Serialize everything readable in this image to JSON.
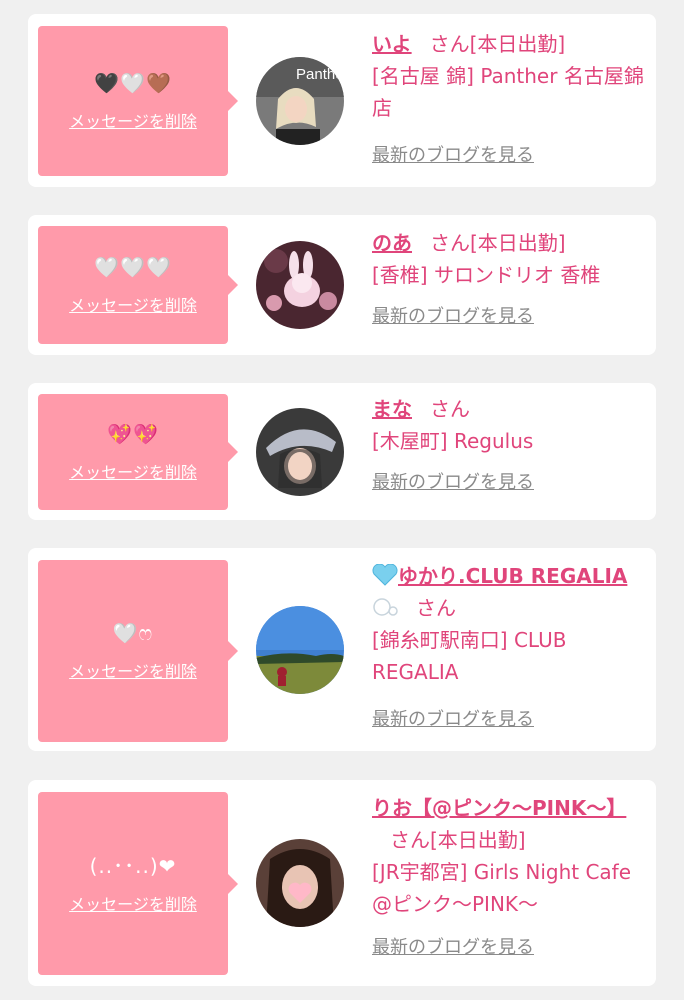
{
  "cards": [
    {
      "message": "🖤🤍🤎",
      "delete_label": "メッセージを削除",
      "name": "いよ",
      "san": "さん",
      "status": "[本日出勤]",
      "shop": "[名古屋 錦] Panther 名古屋錦店",
      "blog_label": "最新のブログを見る",
      "avatar_text": "Panther"
    },
    {
      "message": "🤍🤍🤍",
      "delete_label": "メッセージを削除",
      "name": "のあ",
      "san": "さん",
      "status": "[本日出勤]",
      "shop": "[香椎] サロンドリオ 香椎",
      "blog_label": "最新のブログを見る"
    },
    {
      "message": "💖💖",
      "delete_label": "メッセージを削除",
      "name": "まな",
      "san": "さん",
      "status": "",
      "shop": "[木屋町] Regulus",
      "blog_label": "最新のブログを見る"
    },
    {
      "message": "🤍ෆ",
      "delete_label": "メッセージを削除",
      "name": "ゆかり.CLUB REGALIA",
      "san": "さん",
      "status": "",
      "shop": "[錦糸町駅南口] CLUB REGALIA",
      "blog_label": "最新のブログを見る"
    },
    {
      "message": "(..･･..)❤",
      "delete_label": "メッセージを削除",
      "name": "りお【@ピンク〜PINK〜】",
      "san": "さん",
      "status": "[本日出勤]",
      "shop": "[JR宇都宮] Girls Night Cafe @ピンク〜PINK〜",
      "blog_label": "最新のブログを見る"
    }
  ],
  "colors": {
    "accent": "#e0457b",
    "bubble": "#ff9aaa",
    "background": "#f0f0f0",
    "blog_link": "#8a8a8a"
  }
}
